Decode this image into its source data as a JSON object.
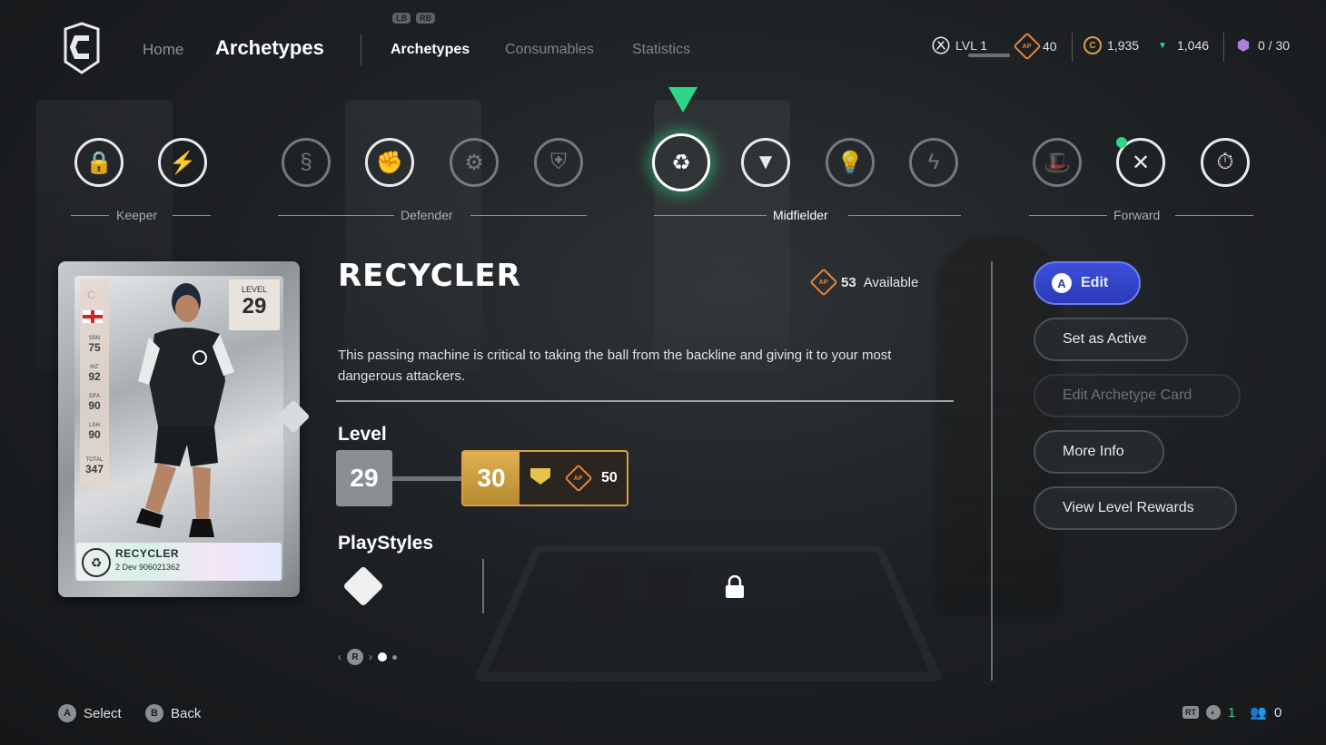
{
  "nav": {
    "home": "Home",
    "title": "Archetypes",
    "lb": "LB",
    "rb": "RB",
    "tabs": [
      "Archetypes",
      "Consumables",
      "Statistics"
    ]
  },
  "currencies": {
    "level": "LVL 1",
    "ap": "40",
    "coins": "1,935",
    "points": "1,046",
    "sp": "0 / 30"
  },
  "categories": [
    "Keeper",
    "Defender",
    "Midfielder",
    "Forward"
  ],
  "archetypes": [
    {
      "icon": "keeper-lock-icon"
    },
    {
      "icon": "keeper-sweep-icon"
    },
    {
      "icon": "defender-snake-icon"
    },
    {
      "icon": "defender-fist-icon"
    },
    {
      "icon": "defender-tactics-icon"
    },
    {
      "icon": "defender-shield-icon"
    },
    {
      "icon": "recycle-icon",
      "selected": true
    },
    {
      "icon": "tuxedo-icon"
    },
    {
      "icon": "lightbulb-icon"
    },
    {
      "icon": "lightning-icon"
    },
    {
      "icon": "magician-hat-icon"
    },
    {
      "icon": "crossed-flags-icon",
      "checked": true
    },
    {
      "icon": "stopwatch-icon"
    }
  ],
  "card": {
    "level_label": "LEVEL",
    "level": "29",
    "stats": [
      {
        "label": "SSN",
        "value": "75"
      },
      {
        "label": "INT",
        "value": "92"
      },
      {
        "label": "DFA",
        "value": "90"
      },
      {
        "label": "LSH",
        "value": "90"
      },
      {
        "label": "TOTAL",
        "value": "347"
      }
    ],
    "name": "RECYCLER",
    "subtitle": "2 Dev 906021362"
  },
  "detail": {
    "name": "RECYCLER",
    "available_count": "53",
    "available_label": "Available",
    "ap_badge": "AP",
    "description": "This passing machine is critical to taking the ball from the backline and giving it to your most dangerous attackers.",
    "level_label": "Level",
    "current_level": "29",
    "next_level": "30",
    "next_level_ap": "50",
    "playstyles_label": "PlayStyles",
    "pager_button": "R"
  },
  "actions": {
    "edit_button": "A",
    "edit": "Edit",
    "set_active": "Set as Active",
    "edit_card": "Edit Archetype Card",
    "more_info": "More Info",
    "view_rewards": "View Level Rewards"
  },
  "footer": {
    "select_button": "A",
    "select": "Select",
    "back_button": "B",
    "back": "Back",
    "rt": "RT",
    "party_count": "1",
    "friends_count": "0"
  },
  "colors": {
    "accent_green": "#2fd68a",
    "primary_blue": "#3d4fd8",
    "ap_orange": "#e8843a",
    "level_gold": "#d9a040"
  }
}
